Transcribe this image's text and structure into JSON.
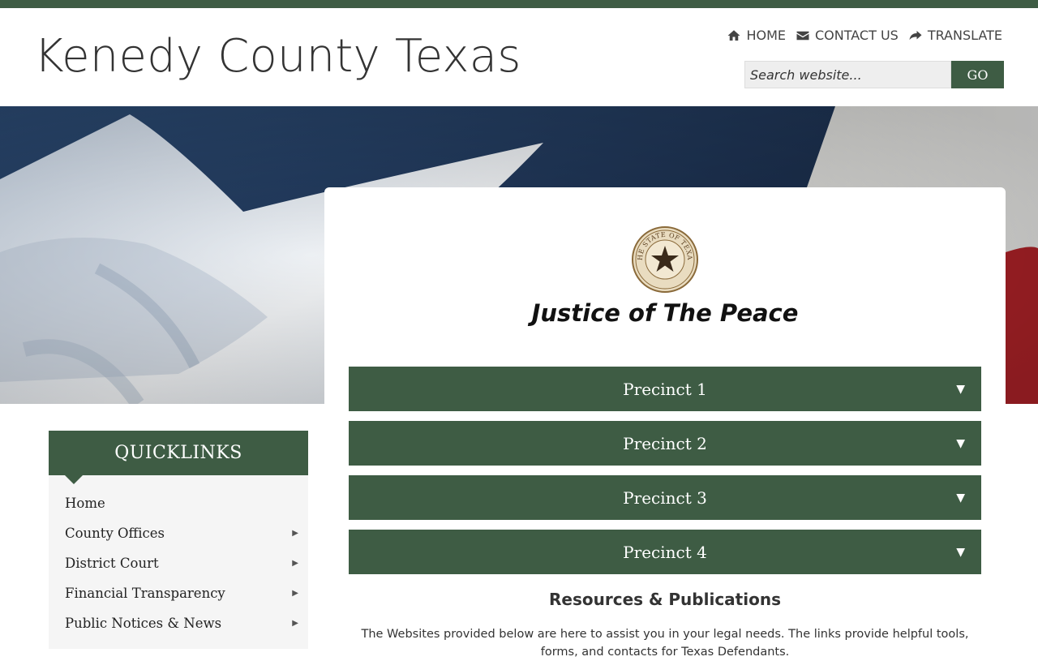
{
  "header": {
    "site_title": "Kenedy County Texas",
    "nav": [
      {
        "label": "HOME",
        "icon": "home-icon"
      },
      {
        "label": "CONTACT US",
        "icon": "envelope-icon"
      },
      {
        "label": "TRANSLATE",
        "icon": "share-arrow-icon"
      }
    ],
    "search": {
      "placeholder": "Search website...",
      "value": "",
      "button_label": "GO"
    }
  },
  "colors": {
    "brand_green": "#3e5c44",
    "panel_gray": "#f5f5f5"
  },
  "main": {
    "seal_icon": "texas-state-seal-icon",
    "seal_text": "THE STATE OF TEXAS",
    "title": "Justice of The Peace",
    "precincts": [
      {
        "label": "Precinct 1",
        "caret": "▼"
      },
      {
        "label": "Precinct 2",
        "caret": "▼"
      },
      {
        "label": "Precinct 3",
        "caret": "▼"
      },
      {
        "label": "Precinct 4",
        "caret": "▼"
      }
    ],
    "resources_title": "Resources & Publications",
    "resources_text": "The Websites provided below are here to assist you in your legal needs. The links provide helpful tools, forms, and contacts for Texas Defendants."
  },
  "quicklinks": {
    "title": "QUICKLINKS",
    "items": [
      {
        "label": "Home",
        "arrow": ""
      },
      {
        "label": "County Offices",
        "arrow": "▶"
      },
      {
        "label": "District Court",
        "arrow": "▶"
      },
      {
        "label": "Financial Transparency",
        "arrow": "▶"
      },
      {
        "label": "Public Notices & News",
        "arrow": "▶"
      }
    ]
  }
}
